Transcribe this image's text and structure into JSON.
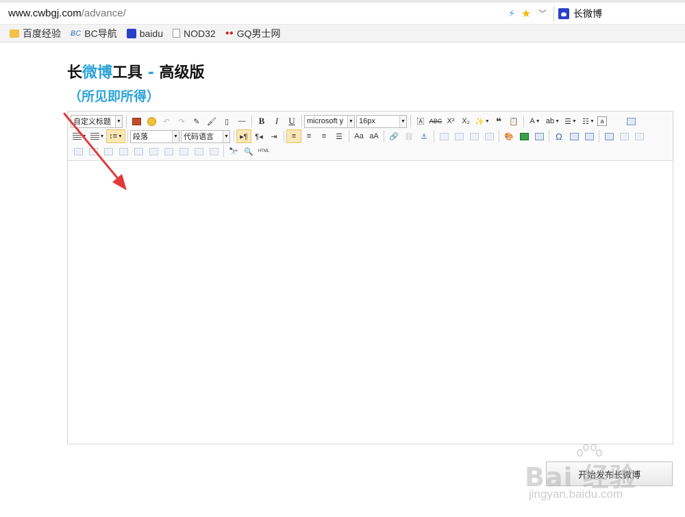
{
  "browser": {
    "url_host": "www.cwbgj.com",
    "url_path": "/advance/",
    "tab_title": "长微博"
  },
  "bookmarks": [
    {
      "icon": "folder-icon",
      "label": "百度经验"
    },
    {
      "icon": "bc-icon",
      "label": "BC导航"
    },
    {
      "icon": "paw-icon",
      "label": "baidu"
    },
    {
      "icon": "document-icon",
      "label": "NOD32"
    },
    {
      "icon": "gq-icon",
      "label": "GQ男士网"
    }
  ],
  "page": {
    "title_part1": "长",
    "title_part2": "微博",
    "title_part3": "工具",
    "title_part4": " - ",
    "title_part5": "高级版",
    "subtitle": "（所见即所得）"
  },
  "toolbar": {
    "heading_select": "自定义标题",
    "font_family": "microsoft y",
    "font_size": "16px",
    "paragraph_select": "段落",
    "code_lang_select": "代码语言",
    "bold": "B",
    "italic": "I",
    "underline": "U"
  },
  "submit_button": "开始发布长微博",
  "watermark": {
    "main": "Bai 经验",
    "sub": "jingyan.baidu.com"
  },
  "colors": {
    "accent": "#2aa3d8",
    "arrow": "#e03a3a"
  }
}
